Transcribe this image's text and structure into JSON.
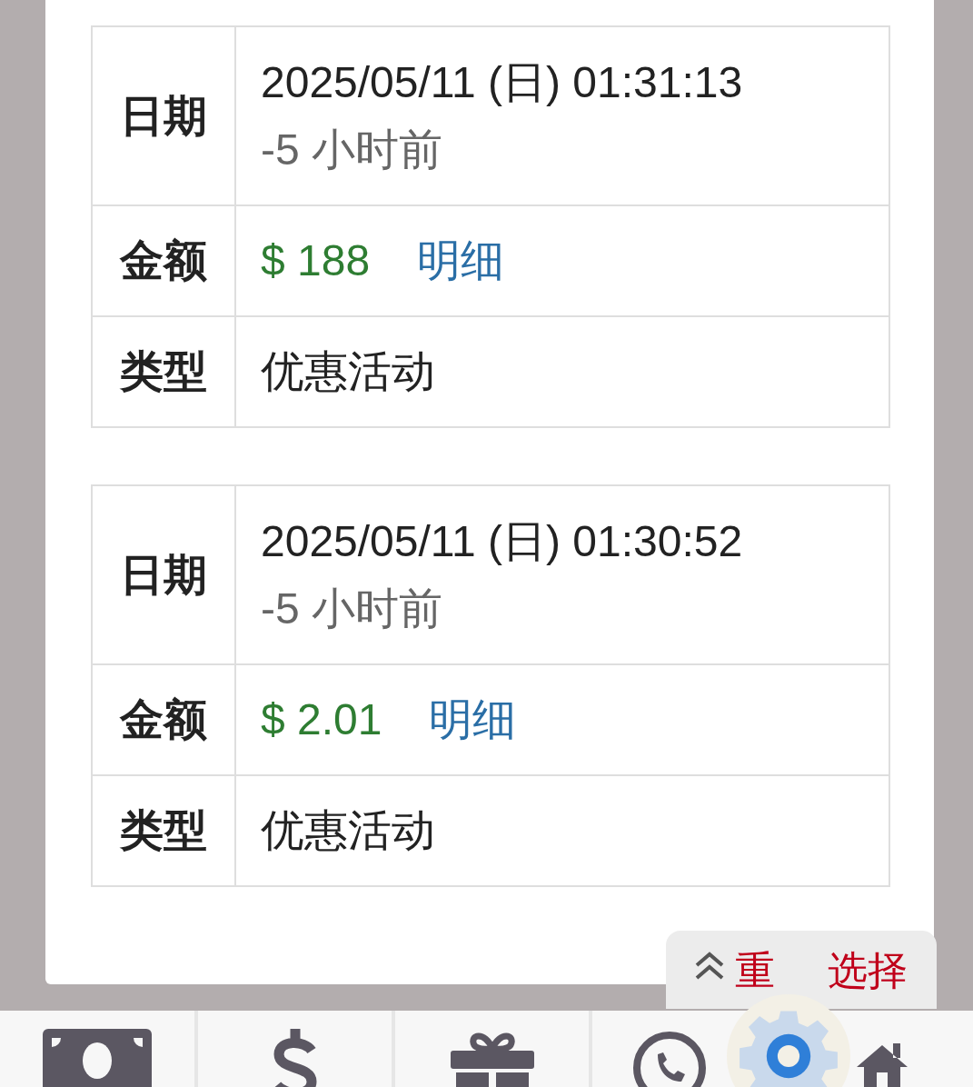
{
  "records": [
    {
      "rows": [
        {
          "kind": "date",
          "label": "日期",
          "value": "2025/05/11 (日) 01:31:13",
          "sub": "-5 小时前"
        },
        {
          "kind": "amount",
          "label": "金额",
          "value": "$ 188",
          "link": "明细"
        },
        {
          "kind": "text",
          "label": "类型",
          "value": "优惠活动"
        }
      ]
    },
    {
      "rows": [
        {
          "kind": "date",
          "label": "日期",
          "value": "2025/05/11 (日) 01:30:52",
          "sub": "-5 小时前"
        },
        {
          "kind": "amount",
          "label": "金额",
          "value": "$ 2.01",
          "link": "明细"
        },
        {
          "kind": "text",
          "label": "类型",
          "value": "优惠活动"
        }
      ]
    }
  ],
  "reselect_button": {
    "label_start": "重",
    "label_end": "选择"
  },
  "bottom_nav": [
    {
      "kind": "cash"
    },
    {
      "kind": "dollar"
    },
    {
      "kind": "gift"
    },
    {
      "kind": "chat"
    },
    {
      "kind": "home"
    }
  ]
}
